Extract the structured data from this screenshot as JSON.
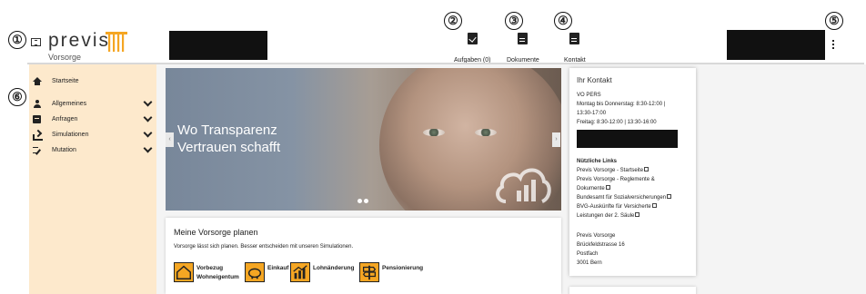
{
  "callouts": [
    "①",
    "②",
    "③",
    "④",
    "⑤",
    "⑥"
  ],
  "header": {
    "logo_text": "previs",
    "logo_sub": "Vorsorge",
    "nav": [
      {
        "label": "Aufgaben (0)",
        "icon": "clipboard-check-icon"
      },
      {
        "label": "Dokumente",
        "icon": "document-icon"
      },
      {
        "label": "Kontakt",
        "icon": "document-icon"
      }
    ]
  },
  "sidebar": {
    "items": [
      {
        "label": "Startseite",
        "icon": "home-icon"
      },
      {
        "label": "Allgemeines",
        "icon": "person-icon"
      },
      {
        "label": "Anfragen",
        "icon": "chat-icon"
      },
      {
        "label": "Simulationen",
        "icon": "simulation-icon"
      },
      {
        "label": "Mutation",
        "icon": "edit-list-icon"
      }
    ]
  },
  "hero": {
    "line1": "Wo Transparenz",
    "line2": "Vertrauen schafft"
  },
  "plan": {
    "title": "Meine Vorsorge planen",
    "subtitle": "Vorsorge lässt sich planen. Besser entscheiden mit unseren Simulationen.",
    "tiles": [
      {
        "line1": "Vorbezug",
        "line2": "Wohneigentum",
        "icon": "house-icon"
      },
      {
        "line1": "Einkauf",
        "line2": "",
        "icon": "piggy-bank-icon"
      },
      {
        "line1": "Lohnänderung",
        "line2": "",
        "icon": "chart-icon"
      },
      {
        "line1": "Pensionierung",
        "line2": "",
        "icon": "signpost-icon"
      }
    ]
  },
  "contact": {
    "title": "Ihr Kontakt",
    "team": "VO PERS",
    "hours1": "Montag bis Donnerstag: 8:30-12:00 |",
    "hours2": "13:30-17:00",
    "hours3": "Freitag: 8:30-12:00 | 13:30-16:00",
    "links_title": "Nützliche Links",
    "links": [
      "Previs Vorsorge - Startseite",
      "Previs Vorsorge - Reglemente &",
      "Dokumente",
      "Bundesamt für Sozialversicherungen",
      "BVG-Auskünfte für Versicherte",
      "Leistungen der 2. Säule"
    ],
    "address": [
      "Previs Vorsorge",
      "Brückfeldstrasse 16",
      "Postfach",
      "3001 Bern"
    ]
  },
  "colors": {
    "accent": "#f5a623",
    "sidebar_bg": "#fde9cc",
    "logo": "#f5a623"
  }
}
